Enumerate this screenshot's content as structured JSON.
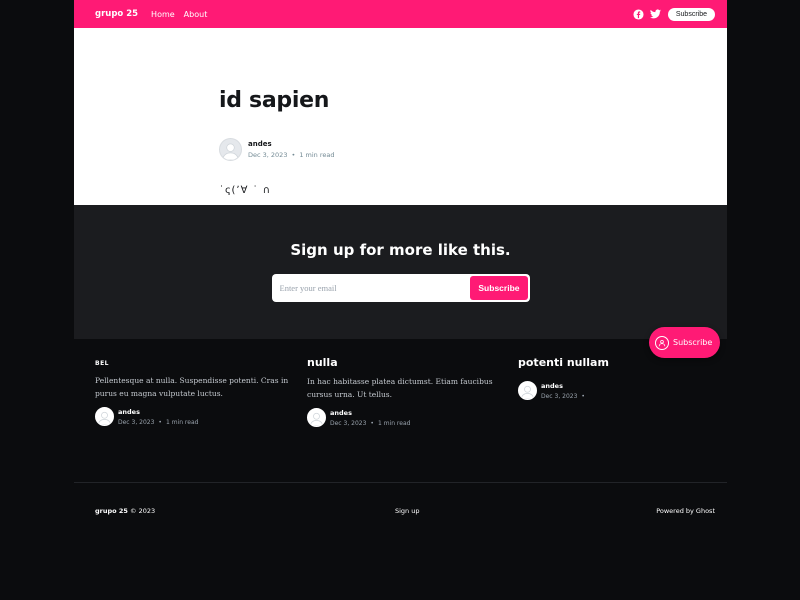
{
  "nav": {
    "brand": "grupo 25",
    "links": [
      "Home",
      "About"
    ],
    "subscribe_label": "Subscribe"
  },
  "post": {
    "title": "id sapien",
    "author": "andes",
    "date": "Dec 3, 2023",
    "read_time": "1 min read",
    "body": "˙ҁ(ʼ∀ ˙ ∩"
  },
  "cta": {
    "title": "Sign up for more like this.",
    "placeholder": "Enter your email",
    "button": "Subscribe"
  },
  "feed": [
    {
      "title": "BEL",
      "excerpt": "Pellentesque at nulla. Suspendisse potenti. Cras in purus eu magna vulputate luctus.",
      "author": "andes",
      "date": "Dec 3, 2023",
      "read_time": "1 min read"
    },
    {
      "title": "nulla",
      "excerpt": "In hac habitasse platea dictumst. Etiam faucibus cursus urna. Ut tellus.",
      "author": "andes",
      "date": "Dec 3, 2023",
      "read_time": "1 min read"
    },
    {
      "title": "potenti nullam",
      "excerpt": "",
      "author": "andes",
      "date": "Dec 3, 2023",
      "read_time": ""
    }
  ],
  "floating_subscribe": "Subscribe",
  "footer": {
    "brand": "grupo 25",
    "copyright": "© 2023",
    "signup": "Sign up",
    "powered": "Powered by Ghost"
  },
  "colors": {
    "accent": "#ff1a75",
    "dark_bg": "#0b0c0e",
    "cta_bg": "#1b1c1f"
  },
  "icons": [
    "facebook-icon",
    "twitter-icon",
    "avatar-icon",
    "subscribe-ring-icon"
  ]
}
